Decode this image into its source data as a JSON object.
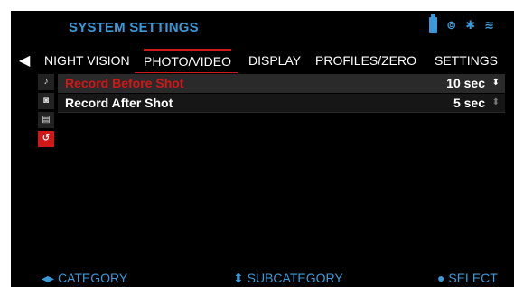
{
  "header": {
    "title": "SYSTEM SETTINGS",
    "status_icons": [
      "battery-icon",
      "gps-icon",
      "bluetooth-icon",
      "wifi-icon"
    ]
  },
  "tabs": [
    {
      "label": "NIGHT VISION"
    },
    {
      "label": "PHOTO/VIDEO",
      "active": true
    },
    {
      "label": "DISPLAY"
    },
    {
      "label": "PROFILES/ZERO"
    },
    {
      "label": "SETTINGS"
    }
  ],
  "sidebar": {
    "icons": [
      "microphone-icon",
      "camera-icon",
      "sd-card-icon",
      "reset-icon"
    ],
    "active": "reset-icon"
  },
  "settings": [
    {
      "label": "Record Before Shot",
      "value": "10 sec",
      "selected": true
    },
    {
      "label": "Record After Shot",
      "value": "5 sec",
      "selected": false
    }
  ],
  "footer": {
    "category": "CATEGORY",
    "subcategory": "SUBCATEGORY",
    "select": "SELECT"
  },
  "colors": {
    "accent_blue": "#3a9ad9",
    "highlight_red": "#d01818",
    "background": "#000000"
  }
}
